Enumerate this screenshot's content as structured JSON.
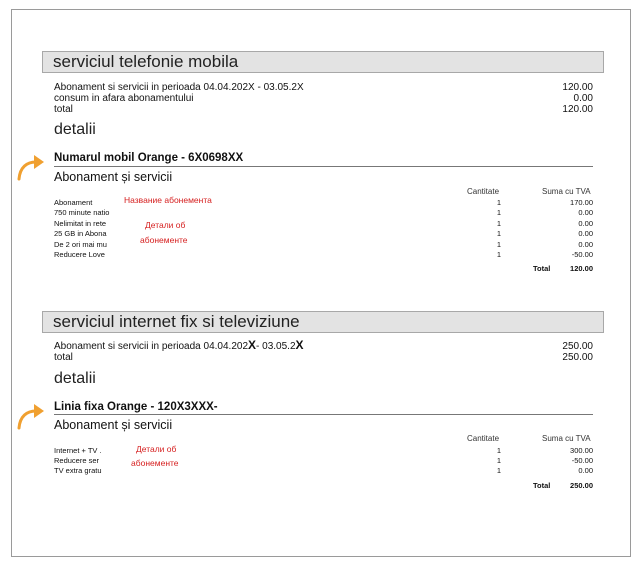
{
  "s1": {
    "header": "serviciul telefonie mobila",
    "period_label": "Abonament si servicii in perioada 04.04.202",
    "period_x1": "X",
    "period_mid": " - 03.05.2",
    "period_x2": "X",
    "period_value": "120.00",
    "consum_label": "consum in afara abonamentului",
    "consum_value": "0.00",
    "total_label": "total",
    "total_value": "120.00",
    "detalii": "detalii",
    "line_title": "Numarul mobil Orange - 6X0698XX",
    "subtitle": "Abonament și servicii",
    "col_qty": "Cantitate",
    "col_sum": "Suma cu TVA",
    "items": [
      {
        "name": "Abonament",
        "qty": "1",
        "amount": "170.00"
      },
      {
        "name": "750 minute natio",
        "qty": "1",
        "amount": "0.00"
      },
      {
        "name": "Nelimitat in rete",
        "qty": "1",
        "amount": "0.00"
      },
      {
        "name": "25 GB in Abona",
        "qty": "1",
        "amount": "0.00"
      },
      {
        "name": "De 2 ori mai mu",
        "qty": "1",
        "amount": "0.00"
      },
      {
        "name": "Reducere Love",
        "qty": "1",
        "amount": "-50.00"
      }
    ],
    "table_total_label": "Total",
    "table_total_value": "120.00",
    "note_name": "Название абонемента",
    "note_details_1": "Детали об",
    "note_details_2": "абонементе"
  },
  "s2": {
    "header": "serviciul internet fix si televiziune",
    "period_label": "Abonament si servicii in perioada 04.04.202",
    "period_x1": "X",
    "period_mid": "- 03.05.2",
    "period_x2": "X",
    "period_value": "250.00",
    "total_label": "total",
    "total_value": "250.00",
    "detalii": "detalii",
    "line_title": "Linia fixa Orange - 120X3XXX-",
    "subtitle": "Abonament și servicii",
    "col_qty": "Cantitate",
    "col_sum": "Suma cu TVA",
    "items": [
      {
        "name": "Internet + TV .",
        "qty": "1",
        "amount": "300.00"
      },
      {
        "name": "Reducere ser",
        "qty": "1",
        "amount": "-50.00"
      },
      {
        "name": "TV extra gratu",
        "qty": "1",
        "amount": "0.00"
      }
    ],
    "table_total_label": "Total",
    "table_total_value": "250.00",
    "note_details_1": "Детали об",
    "note_details_2": "абонементе"
  },
  "colors": {
    "accent_arrow": "#f0a030",
    "note_red": "#d62020",
    "header_bg": "#e3e3e3"
  }
}
